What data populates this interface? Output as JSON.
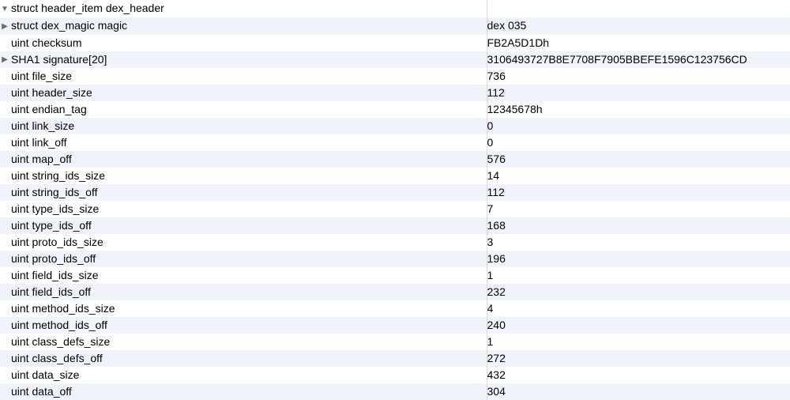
{
  "root": {
    "label": "struct header_item dex_header",
    "value": "",
    "expanded": true
  },
  "rows": [
    {
      "label": "struct dex_magic magic",
      "value": "dex 035",
      "expandable": true,
      "expanded": false
    },
    {
      "label": "uint checksum",
      "value": "FB2A5D1Dh",
      "expandable": false
    },
    {
      "label": "SHA1 signature[20]",
      "value": "3106493727B8E7708F7905BBEFE1596C123756CD",
      "expandable": true,
      "expanded": false
    },
    {
      "label": "uint file_size",
      "value": "736",
      "expandable": false
    },
    {
      "label": "uint header_size",
      "value": "112",
      "expandable": false
    },
    {
      "label": "uint endian_tag",
      "value": "12345678h",
      "expandable": false
    },
    {
      "label": "uint link_size",
      "value": "0",
      "expandable": false
    },
    {
      "label": "uint link_off",
      "value": "0",
      "expandable": false
    },
    {
      "label": "uint map_off",
      "value": "576",
      "expandable": false
    },
    {
      "label": "uint string_ids_size",
      "value": "14",
      "expandable": false
    },
    {
      "label": "uint string_ids_off",
      "value": "112",
      "expandable": false
    },
    {
      "label": "uint type_ids_size",
      "value": "7",
      "expandable": false
    },
    {
      "label": "uint type_ids_off",
      "value": "168",
      "expandable": false
    },
    {
      "label": "uint proto_ids_size",
      "value": "3",
      "expandable": false
    },
    {
      "label": "uint proto_ids_off",
      "value": "196",
      "expandable": false
    },
    {
      "label": "uint field_ids_size",
      "value": "1",
      "expandable": false
    },
    {
      "label": "uint field_ids_off",
      "value": "232",
      "expandable": false
    },
    {
      "label": "uint method_ids_size",
      "value": "4",
      "expandable": false
    },
    {
      "label": "uint method_ids_off",
      "value": "240",
      "expandable": false
    },
    {
      "label": "uint class_defs_size",
      "value": "1",
      "expandable": false
    },
    {
      "label": "uint class_defs_off",
      "value": "272",
      "expandable": false
    },
    {
      "label": "uint data_size",
      "value": "432",
      "expandable": false
    },
    {
      "label": "uint data_off",
      "value": "304",
      "expandable": false
    }
  ],
  "glyphs": {
    "expanded": "▼",
    "collapsed": "▶"
  },
  "watermark": ""
}
